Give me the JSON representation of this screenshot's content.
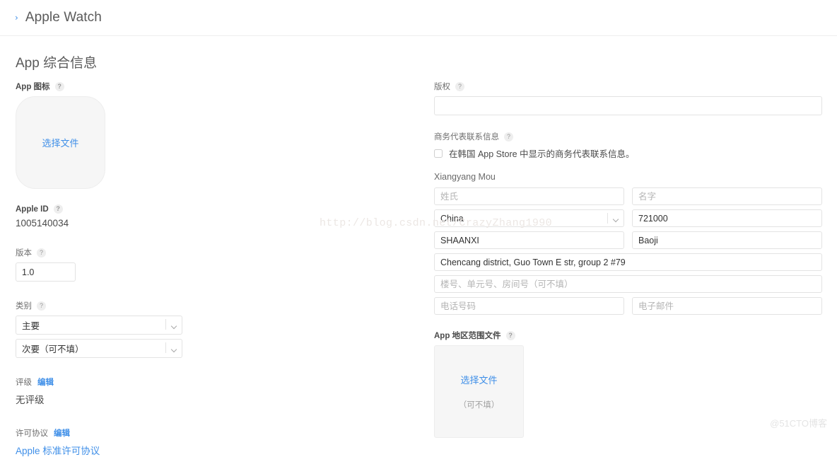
{
  "header": {
    "chevron_icon": "chevron-right-icon",
    "breadcrumb_title": "Apple Watch"
  },
  "page": {
    "title": "App 综合信息"
  },
  "help_icon_glyph": "?",
  "left": {
    "app_icon": {
      "label": "App 图标",
      "upload_link": "选择文件"
    },
    "apple_id": {
      "label": "Apple ID",
      "value": "1005140034"
    },
    "version": {
      "label": "版本",
      "value": "1.0"
    },
    "category": {
      "label": "类别",
      "primary_value": "主要",
      "secondary_value": "次要（可不填）"
    },
    "rating": {
      "label": "评级",
      "edit_label": "编辑",
      "value": "无评级"
    },
    "license": {
      "label": "许可协议",
      "edit_label": "编辑",
      "link_text": "Apple 标准许可协议"
    }
  },
  "right": {
    "copyright": {
      "label": "版权",
      "value": "",
      "placeholder": ""
    },
    "business_contact": {
      "label": "商务代表联系信息",
      "checkbox_label": "在韩国 App Store 中显示的商务代表联系信息。",
      "checked": false,
      "name_line": "Xiangyang Mou",
      "fields": {
        "last_name_placeholder": "姓氏",
        "last_name_value": "",
        "first_name_placeholder": "名字",
        "first_name_value": "",
        "country_value": "China",
        "postal_code_value": "721000",
        "postal_code_placeholder": "",
        "province_value": "SHAANXI",
        "city_value": "Baoji",
        "address1_value": "Chencang district, Guo Town E str, group 2 #79",
        "address2_placeholder": "楼号、单元号、房间号（可不填）",
        "address2_value": "",
        "phone_placeholder": "电话号码",
        "phone_value": "",
        "email_placeholder": "电子邮件",
        "email_value": ""
      }
    },
    "region_file": {
      "label": "App 地区范围文件",
      "upload_link": "选择文件",
      "optional_note": "（可不填）"
    }
  },
  "watermarks": {
    "url": "http://blog.csdn.net/CrazyZhang1990",
    "corner": "@51CTO博客"
  },
  "colors": {
    "accent_blue": "#3f8fe8",
    "label_gray": "#6e6e6e",
    "border_gray": "#e3e3e3",
    "upload_bg": "#f6f6f6"
  }
}
